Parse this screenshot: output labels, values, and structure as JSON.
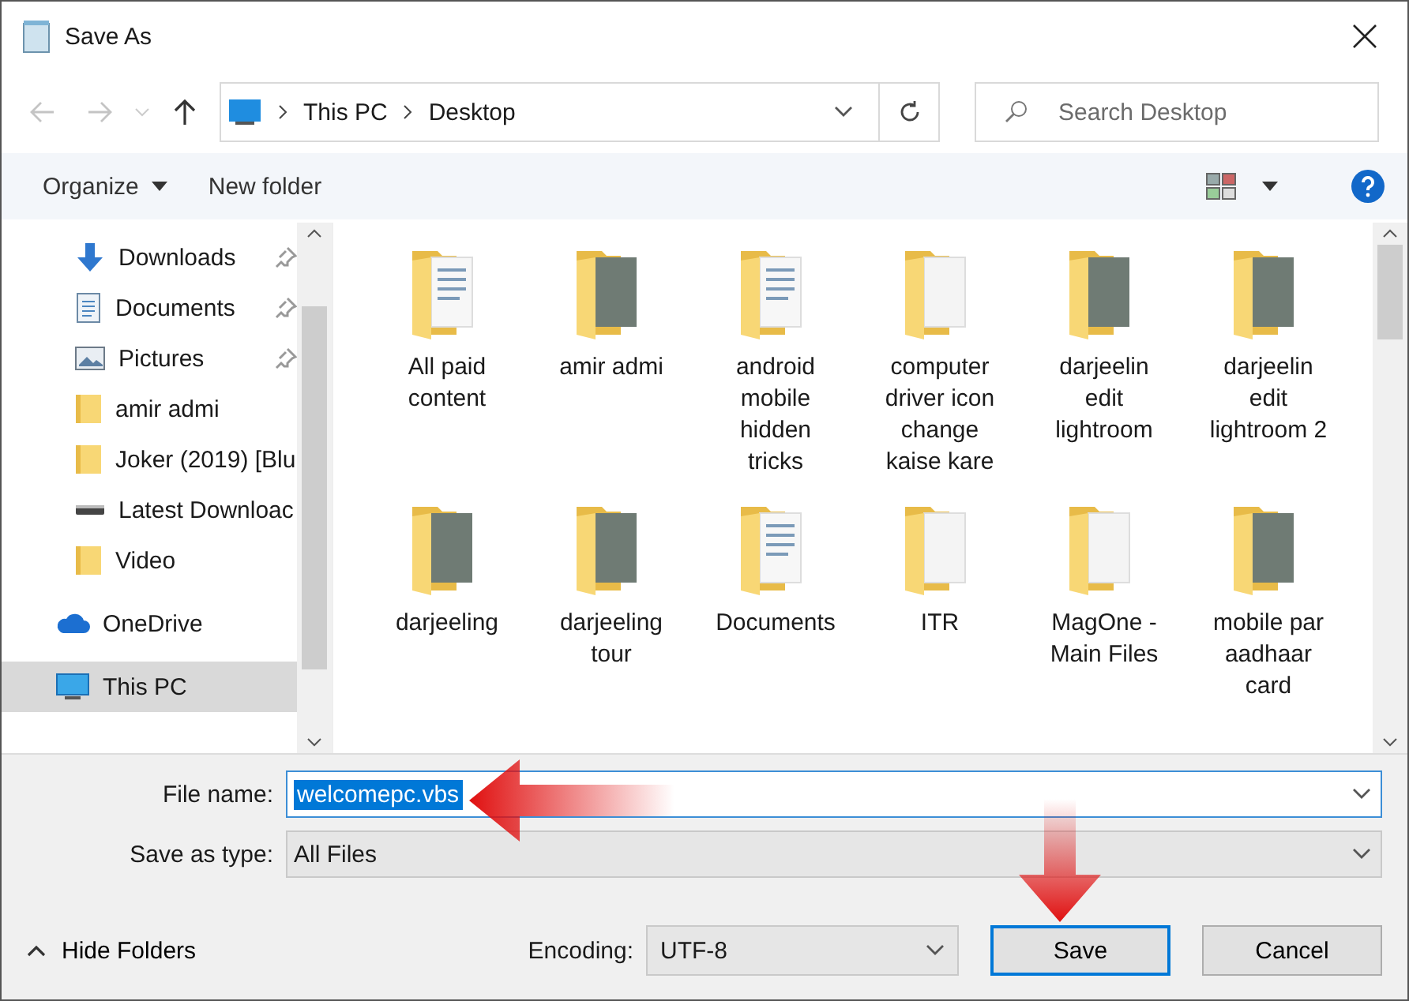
{
  "window": {
    "title": "Save As"
  },
  "navigation": {
    "back_disabled": true,
    "forward_disabled": true,
    "path": [
      "This PC",
      "Desktop"
    ],
    "search_placeholder": "Search Desktop"
  },
  "toolbar": {
    "organize": "Organize",
    "new_folder": "New folder"
  },
  "sidebar": {
    "items": [
      {
        "label": "Downloads",
        "kind": "download",
        "pinned": true,
        "selected": false
      },
      {
        "label": "Documents",
        "kind": "document",
        "pinned": true,
        "selected": false
      },
      {
        "label": "Pictures",
        "kind": "picture",
        "pinned": true,
        "selected": false
      },
      {
        "label": "amir admi",
        "kind": "folder",
        "pinned": false,
        "selected": false
      },
      {
        "label": "Joker (2019) [Blu",
        "kind": "folder",
        "pinned": false,
        "selected": false
      },
      {
        "label": "Latest Downloac",
        "kind": "drive",
        "pinned": false,
        "selected": false
      },
      {
        "label": "Video",
        "kind": "folder",
        "pinned": false,
        "selected": false
      },
      {
        "label": "OneDrive",
        "kind": "cloud",
        "pinned": false,
        "selected": false,
        "gap": true
      },
      {
        "label": "This PC",
        "kind": "computer",
        "pinned": false,
        "selected": true,
        "gap": true
      }
    ]
  },
  "files": [
    {
      "name": "All paid content",
      "kind": "document"
    },
    {
      "name": "amir admi",
      "kind": "photo"
    },
    {
      "name": "android mobile hidden tricks",
      "kind": "document"
    },
    {
      "name": "computer driver icon change kaise kare",
      "kind": "plain"
    },
    {
      "name": "darjeelin edit lightroom",
      "kind": "photo"
    },
    {
      "name": "darjeelin edit lightroom 2",
      "kind": "photo"
    },
    {
      "name": "darjeeling",
      "kind": "photo"
    },
    {
      "name": "darjeeling tour",
      "kind": "photo"
    },
    {
      "name": "Documents",
      "kind": "document"
    },
    {
      "name": "ITR",
      "kind": "plain"
    },
    {
      "name": "MagOne - Main Files",
      "kind": "plain"
    },
    {
      "name": "mobile par aadhaar card",
      "kind": "photo"
    }
  ],
  "form": {
    "file_name_label": "File name:",
    "file_name": "welcomepc.vbs",
    "file_name_selected": true,
    "type_label": "Save as type:",
    "type": "All Files"
  },
  "footer": {
    "hide_folders": "Hide Folders",
    "encoding_label": "Encoding:",
    "encoding": "UTF-8",
    "save": "Save",
    "cancel": "Cancel"
  }
}
